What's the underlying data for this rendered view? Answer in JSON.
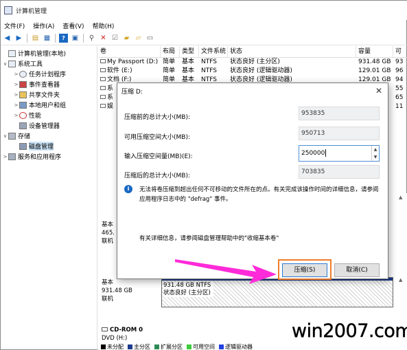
{
  "window": {
    "title": "计算机管理"
  },
  "menu": [
    "文件(F)",
    "操作(A)",
    "查看(V)",
    "帮助(H)"
  ],
  "toolbar": {
    "icons": [
      "back-arrow-icon",
      "forward-arrow-icon",
      "folder-up-icon",
      "console-tree-icon",
      "help-icon",
      "properties-icon",
      "connect-icon",
      "delete-icon",
      "check-icon",
      "open-folder-icon",
      "new-folder-icon",
      "panel-icon"
    ]
  },
  "tree": [
    {
      "label": "计算机管理(本地)",
      "level": 0,
      "icon": "computer-icon",
      "exp": ""
    },
    {
      "label": "系统工具",
      "level": 1,
      "icon": "tools-icon",
      "exp": "∨"
    },
    {
      "label": "任务计划程序",
      "level": 2,
      "icon": "clock-icon",
      "exp": ">"
    },
    {
      "label": "事件查看器",
      "level": 2,
      "icon": "event-viewer-icon",
      "exp": ">"
    },
    {
      "label": "共享文件夹",
      "level": 2,
      "icon": "shared-folder-icon",
      "exp": ">"
    },
    {
      "label": "本地用户和组",
      "level": 2,
      "icon": "users-icon",
      "exp": ">"
    },
    {
      "label": "性能",
      "level": 2,
      "icon": "performance-icon",
      "exp": ">"
    },
    {
      "label": "设备管理器",
      "level": 2,
      "icon": "device-manager-icon",
      "exp": ""
    },
    {
      "label": "存储",
      "level": 1,
      "icon": "storage-icon",
      "exp": "∨"
    },
    {
      "label": "磁盘管理",
      "level": 2,
      "icon": "disk-management-icon",
      "exp": "",
      "selected": true
    },
    {
      "label": "服务和应用程序",
      "level": 1,
      "icon": "services-icon",
      "exp": ">"
    }
  ],
  "list": {
    "headers": [
      "卷",
      "布局",
      "类型",
      "文件系统",
      "状态",
      "容量",
      "可"
    ],
    "rows": [
      [
        "My Passport (D:)",
        "简单",
        "基本",
        "NTFS",
        "状态良好 (主分区)",
        "931.48 GB",
        "93"
      ],
      [
        "软件 (E:)",
        "简单",
        "基本",
        "NTFS",
        "状态良好 (逻辑驱动器)",
        "129.01 GB",
        "96"
      ],
      [
        "文档 (F:)",
        "简单",
        "基本",
        "NTFS",
        "状态良好 (逻辑驱动器)",
        "129.01 GB",
        "94"
      ],
      [
        "系",
        "",
        "",
        "",
        "",
        "",
        "55"
      ],
      [
        "系",
        "",
        "",
        "",
        "",
        "",
        "65"
      ],
      [
        "娱",
        "",
        "",
        "",
        "",
        "",
        "11"
      ]
    ]
  },
  "disks": {
    "disk1": {
      "lines": [
        "基本",
        "465.",
        "联机"
      ]
    },
    "disk2": {
      "lines": [
        "基本",
        "931.48 GB",
        "联机"
      ],
      "partition": [
        "931.48 GB NTFS",
        "状态良好 (主分区)"
      ]
    },
    "cdrom": {
      "title": "CD-ROM 0",
      "lines": [
        "DVD (H:)"
      ]
    }
  },
  "legend": [
    {
      "label": "未分配",
      "color": "#000000"
    },
    {
      "label": "主分区",
      "color": "#1c3a8c"
    },
    {
      "label": "扩展分区",
      "color": "#2e8b57"
    },
    {
      "label": "可用空间",
      "color": "#3ccc3c"
    },
    {
      "label": "逻辑驱动器",
      "color": "#2240e0"
    }
  ],
  "dialog": {
    "title": "压缩 D:",
    "total_before_label": "压缩前的总计大小(MB):",
    "total_before_value": "953835",
    "available_label": "可用压缩空间大小(MB):",
    "available_value": "950713",
    "input_label": "输入压缩空间量(MB)(E):",
    "input_value": "250000",
    "total_after_label": "压缩后的总计大小(MB):",
    "total_after_value": "703835",
    "info_text": "无法将卷压缩到超出任何不可移动的文件所在的点。有关完成该操作时间的详细信息，请参阅应用程序日志中的 \"defrag\" 事件。",
    "help_text": "有关详细信息，请参阅磁盘管理帮助中的\"收缩基本卷\"",
    "ok_label": "压缩(S)",
    "cancel_label": "取消(C)"
  },
  "watermark": "win2007.com",
  "colors": {
    "accent": "#1a68c2",
    "highlight": "#ee7d2b",
    "arrow": "#ff2ad8"
  }
}
